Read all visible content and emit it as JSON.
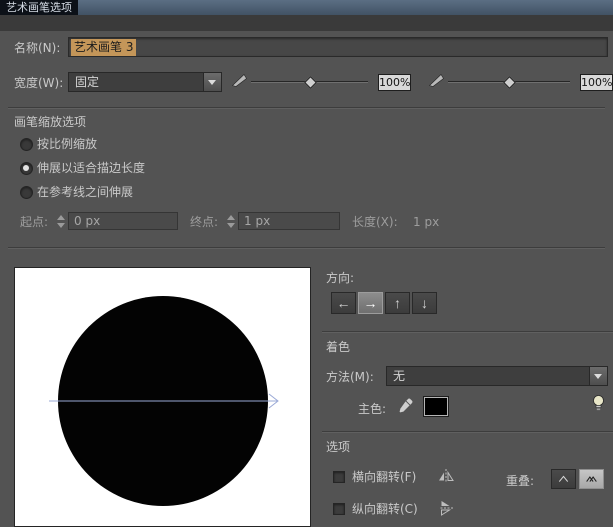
{
  "window": {
    "title": "艺术画笔选项"
  },
  "name_row": {
    "label": "名称(N):",
    "value": "艺术画笔 3"
  },
  "width_row": {
    "label": "宽度(W):",
    "dropdown_value": "固定",
    "slider1_value": "100%",
    "slider2_value": "100%"
  },
  "scale_options": {
    "title": "画笔缩放选项",
    "radios": [
      {
        "label": "按比例缩放",
        "selected": false
      },
      {
        "label": "伸展以适合描边长度",
        "selected": true
      },
      {
        "label": "在参考线之间伸展",
        "selected": false
      }
    ],
    "start_label": "起点:",
    "start_value": "0 px",
    "end_label": "终点:",
    "end_value": "1 px",
    "length_label": "长度(X):",
    "length_value": "1 px"
  },
  "direction": {
    "label": "方向:",
    "buttons": [
      "←",
      "→",
      "↑",
      "↓"
    ],
    "selected": "→"
  },
  "colorization": {
    "title": "着色",
    "method_label": "方法(M):",
    "method_value": "无",
    "key_color_label": "主色:"
  },
  "options": {
    "title": "选项",
    "flip_h_label": "横向翻转(F)",
    "flip_v_label": "纵向翻转(C)",
    "overlap_label": "重叠:"
  },
  "colors": {
    "dialog_bg": "#535353",
    "titlebar_blue": "#4d5f73",
    "selection_highlight": "#c49659",
    "preview_guide": "#9aa9d6",
    "key_color": "#000000"
  }
}
